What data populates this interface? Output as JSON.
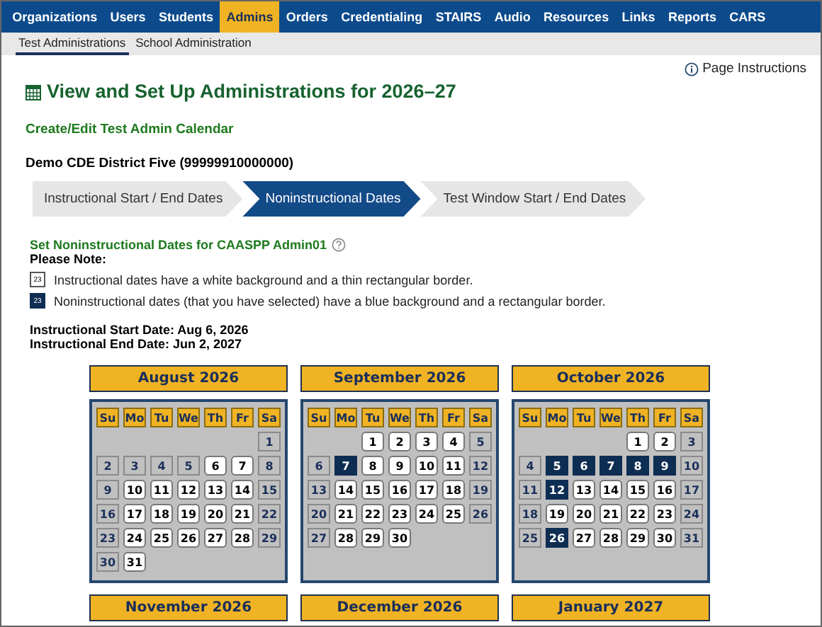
{
  "nav": [
    {
      "label": "Organizations",
      "selected": false
    },
    {
      "label": "Users",
      "selected": false
    },
    {
      "label": "Students",
      "selected": false
    },
    {
      "label": "Admins",
      "selected": true
    },
    {
      "label": "Orders",
      "selected": false
    },
    {
      "label": "Credentialing",
      "selected": false
    },
    {
      "label": "STAIRS",
      "selected": false
    },
    {
      "label": "Audio",
      "selected": false
    },
    {
      "label": "Resources",
      "selected": false
    },
    {
      "label": "Links",
      "selected": false
    },
    {
      "label": "Reports",
      "selected": false
    },
    {
      "label": "CARS",
      "selected": false
    }
  ],
  "subnav": [
    {
      "label": "Test Administrations",
      "selected": true
    },
    {
      "label": "School Administration",
      "selected": false
    }
  ],
  "page_instructions": "Page Instructions",
  "title": "View and Set Up Administrations for 2026–27",
  "calendar_link": "Create/Edit Test Admin Calendar",
  "district": "Demo CDE District Five (99999910000000)",
  "steps": [
    {
      "label": "Instructional Start / End Dates",
      "selected": false
    },
    {
      "label": "Noninstructional Dates",
      "selected": true
    },
    {
      "label": "Test Window Start / End Dates",
      "selected": false
    }
  ],
  "section_title": "Set Noninstructional Dates for CAASPP Admin01",
  "note_label": "Please Note:",
  "legend": [
    {
      "kind": "school",
      "sample": "23",
      "text": "Instructional dates have a white background and a thin rectangular border."
    },
    {
      "kind": "selected",
      "sample": "23",
      "text": "Noninstructional dates (that you have selected) have a blue background and a rectangular border."
    }
  ],
  "start_date": "Instructional Start Date: Aug 6, 2026",
  "end_date": "Instructional End Date: Jun 2, 2027",
  "months": [
    {
      "title": "August 2026",
      "weekdays": [
        "Su",
        "Mo",
        "Tu",
        "We",
        "Th",
        "Fr",
        "Sa"
      ],
      "weeks": [
        [
          {
            "kind": "blank"
          },
          {
            "kind": "blank"
          },
          {
            "kind": "blank"
          },
          {
            "kind": "blank"
          },
          {
            "kind": "blank"
          },
          {
            "kind": "blank"
          },
          {
            "day": "1",
            "kind": "off",
            "selected": false
          }
        ],
        [
          {
            "day": "2",
            "kind": "off",
            "selected": false
          },
          {
            "day": "3",
            "kind": "off",
            "selected": false
          },
          {
            "day": "4",
            "kind": "off",
            "selected": false
          },
          {
            "day": "5",
            "kind": "off",
            "selected": false
          },
          {
            "day": "6",
            "kind": "school",
            "selected": false
          },
          {
            "day": "7",
            "kind": "school",
            "selected": false
          },
          {
            "day": "8",
            "kind": "off",
            "selected": false
          }
        ],
        [
          {
            "day": "9",
            "kind": "off",
            "selected": false
          },
          {
            "day": "10",
            "kind": "school",
            "selected": false
          },
          {
            "day": "11",
            "kind": "school",
            "selected": false
          },
          {
            "day": "12",
            "kind": "school",
            "selected": false
          },
          {
            "day": "13",
            "kind": "school",
            "selected": false
          },
          {
            "day": "14",
            "kind": "school",
            "selected": false
          },
          {
            "day": "15",
            "kind": "off",
            "selected": false
          }
        ],
        [
          {
            "day": "16",
            "kind": "off",
            "selected": false
          },
          {
            "day": "17",
            "kind": "school",
            "selected": false
          },
          {
            "day": "18",
            "kind": "school",
            "selected": false
          },
          {
            "day": "19",
            "kind": "school",
            "selected": false
          },
          {
            "day": "20",
            "kind": "school",
            "selected": false
          },
          {
            "day": "21",
            "kind": "school",
            "selected": false
          },
          {
            "day": "22",
            "kind": "off",
            "selected": false
          }
        ],
        [
          {
            "day": "23",
            "kind": "off",
            "selected": false
          },
          {
            "day": "24",
            "kind": "school",
            "selected": false
          },
          {
            "day": "25",
            "kind": "school",
            "selected": false
          },
          {
            "day": "26",
            "kind": "school",
            "selected": false
          },
          {
            "day": "27",
            "kind": "school",
            "selected": false
          },
          {
            "day": "28",
            "kind": "school",
            "selected": false
          },
          {
            "day": "29",
            "kind": "off",
            "selected": false
          }
        ],
        [
          {
            "day": "30",
            "kind": "off",
            "selected": false
          },
          {
            "day": "31",
            "kind": "school",
            "selected": false
          }
        ]
      ]
    },
    {
      "title": "September 2026",
      "weekdays": [
        "Su",
        "Mo",
        "Tu",
        "We",
        "Th",
        "Fr",
        "Sa"
      ],
      "weeks": [
        [
          {
            "kind": "blank"
          },
          {
            "kind": "blank"
          },
          {
            "day": "1",
            "kind": "school",
            "selected": false
          },
          {
            "day": "2",
            "kind": "school",
            "selected": false
          },
          {
            "day": "3",
            "kind": "school",
            "selected": false
          },
          {
            "day": "4",
            "kind": "school",
            "selected": false
          },
          {
            "day": "5",
            "kind": "off",
            "selected": false
          }
        ],
        [
          {
            "day": "6",
            "kind": "off",
            "selected": false
          },
          {
            "day": "7",
            "kind": "school",
            "selected": true
          },
          {
            "day": "8",
            "kind": "school",
            "selected": false
          },
          {
            "day": "9",
            "kind": "school",
            "selected": false
          },
          {
            "day": "10",
            "kind": "school",
            "selected": false
          },
          {
            "day": "11",
            "kind": "school",
            "selected": false
          },
          {
            "day": "12",
            "kind": "off",
            "selected": false
          }
        ],
        [
          {
            "day": "13",
            "kind": "off",
            "selected": false
          },
          {
            "day": "14",
            "kind": "school",
            "selected": false
          },
          {
            "day": "15",
            "kind": "school",
            "selected": false
          },
          {
            "day": "16",
            "kind": "school",
            "selected": false
          },
          {
            "day": "17",
            "kind": "school",
            "selected": false
          },
          {
            "day": "18",
            "kind": "school",
            "selected": false
          },
          {
            "day": "19",
            "kind": "off",
            "selected": false
          }
        ],
        [
          {
            "day": "20",
            "kind": "off",
            "selected": false
          },
          {
            "day": "21",
            "kind": "school",
            "selected": false
          },
          {
            "day": "22",
            "kind": "school",
            "selected": false
          },
          {
            "day": "23",
            "kind": "school",
            "selected": false
          },
          {
            "day": "24",
            "kind": "school",
            "selected": false
          },
          {
            "day": "25",
            "kind": "school",
            "selected": false
          },
          {
            "day": "26",
            "kind": "off",
            "selected": false
          }
        ],
        [
          {
            "day": "27",
            "kind": "off",
            "selected": false
          },
          {
            "day": "28",
            "kind": "school",
            "selected": false
          },
          {
            "day": "29",
            "kind": "school",
            "selected": false
          },
          {
            "day": "30",
            "kind": "school",
            "selected": false
          }
        ]
      ]
    },
    {
      "title": "October 2026",
      "weekdays": [
        "Su",
        "Mo",
        "Tu",
        "We",
        "Th",
        "Fr",
        "Sa"
      ],
      "weeks": [
        [
          {
            "kind": "blank"
          },
          {
            "kind": "blank"
          },
          {
            "kind": "blank"
          },
          {
            "kind": "blank"
          },
          {
            "day": "1",
            "kind": "school",
            "selected": false
          },
          {
            "day": "2",
            "kind": "school",
            "selected": false
          },
          {
            "day": "3",
            "kind": "off",
            "selected": false
          }
        ],
        [
          {
            "day": "4",
            "kind": "off",
            "selected": false
          },
          {
            "day": "5",
            "kind": "school",
            "selected": true
          },
          {
            "day": "6",
            "kind": "school",
            "selected": true
          },
          {
            "day": "7",
            "kind": "school",
            "selected": true
          },
          {
            "day": "8",
            "kind": "school",
            "selected": true
          },
          {
            "day": "9",
            "kind": "school",
            "selected": true
          },
          {
            "day": "10",
            "kind": "off",
            "selected": false
          }
        ],
        [
          {
            "day": "11",
            "kind": "off",
            "selected": false
          },
          {
            "day": "12",
            "kind": "school",
            "selected": true
          },
          {
            "day": "13",
            "kind": "school",
            "selected": false
          },
          {
            "day": "14",
            "kind": "school",
            "selected": false
          },
          {
            "day": "15",
            "kind": "school",
            "selected": false
          },
          {
            "day": "16",
            "kind": "school",
            "selected": false
          },
          {
            "day": "17",
            "kind": "off",
            "selected": false
          }
        ],
        [
          {
            "day": "18",
            "kind": "off",
            "selected": false
          },
          {
            "day": "19",
            "kind": "school",
            "selected": false
          },
          {
            "day": "20",
            "kind": "school",
            "selected": false
          },
          {
            "day": "21",
            "kind": "school",
            "selected": false
          },
          {
            "day": "22",
            "kind": "school",
            "selected": false
          },
          {
            "day": "23",
            "kind": "school",
            "selected": false
          },
          {
            "day": "24",
            "kind": "off",
            "selected": false
          }
        ],
        [
          {
            "day": "25",
            "kind": "off",
            "selected": false
          },
          {
            "day": "26",
            "kind": "school",
            "selected": true
          },
          {
            "day": "27",
            "kind": "school",
            "selected": false
          },
          {
            "day": "28",
            "kind": "school",
            "selected": false
          },
          {
            "day": "29",
            "kind": "school",
            "selected": false
          },
          {
            "day": "30",
            "kind": "school",
            "selected": false
          },
          {
            "day": "31",
            "kind": "off",
            "selected": false
          }
        ]
      ]
    },
    {
      "title": "November 2026"
    },
    {
      "title": "December 2026"
    },
    {
      "title": "January 2027"
    }
  ]
}
